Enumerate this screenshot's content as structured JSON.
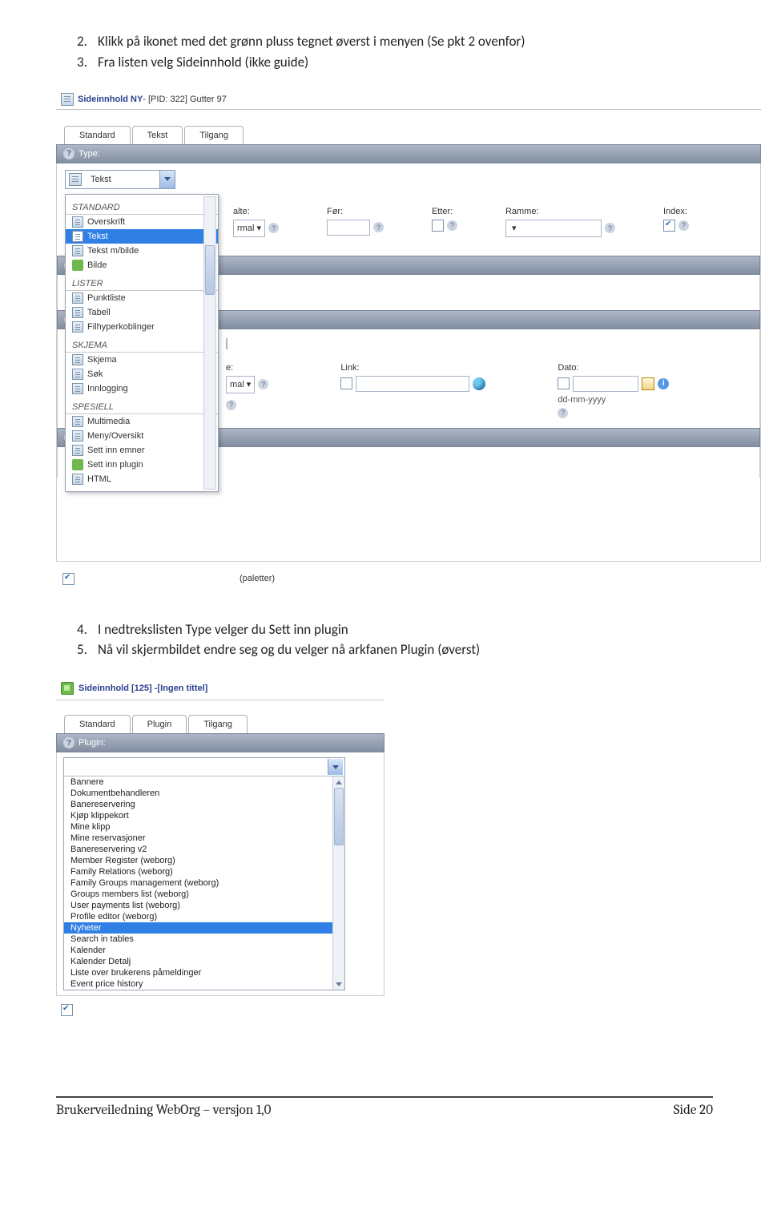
{
  "instructions": {
    "i2_num": "2.",
    "i2_text": "Klikk på ikonet med det grønn pluss tegnet øverst i menyen (Se pkt 2 ovenfor)",
    "i3_num": "3.",
    "i3_text": "Fra listen velg Sideinnhold (ikke guide)",
    "i4_num": "4.",
    "i4_text": "I nedtrekslisten Type velger du Sett inn plugin",
    "i5_num": "5.",
    "i5_text": "Nå vil skjermbildet endre seg og du velger nå arkfanen Plugin (øverst)"
  },
  "s1": {
    "title_prefix": "Sideinnhold NY",
    "title_pid": " - [PID: 322] Gutter 97",
    "tabs": {
      "t1": "Standard",
      "t2": "Tekst",
      "t3": "Tilgang"
    },
    "type_label": "Type:",
    "type_value": "Tekst",
    "groups": {
      "standard": "STANDARD",
      "lister": "LISTER",
      "skjema": "SKJEMA",
      "spesiell": "SPESIELL"
    },
    "items": {
      "overskrift": "Overskrift",
      "tekst": "Tekst",
      "tekst_bilde": "Tekst m/bilde",
      "bilde": "Bilde",
      "punktliste": "Punktliste",
      "tabell": "Tabell",
      "filhyper": "Filhyperkoblinger",
      "skjema": "Skjema",
      "sok": "Søk",
      "innlogging": "Innlogging",
      "multimedia": "Multimedia",
      "meny": "Meny/Oversikt",
      "sett_emner": "Sett inn emner",
      "sett_plugin": "Sett inn plugin",
      "html": "HTML"
    },
    "row_labels": {
      "alte": "alte:",
      "for": "Før:",
      "etter": "Etter:",
      "ramme": "Ramme:",
      "index": "Index:",
      "e_col": "e:",
      "link": "Link:",
      "dato": "Dato:",
      "normal": "rmal",
      "mal": "mal",
      "date_fmt": "dd-mm-yyyy",
      "paletter": "(paletter)"
    }
  },
  "s2": {
    "title_label": "Sideinnhold [125] - ",
    "title_sub": "[Ingen tittel]",
    "tabs": {
      "t1": "Standard",
      "t2": "Plugin",
      "t3": "Tilgang"
    },
    "plugin_label": "Plugin:",
    "options": [
      "Bannere",
      "Dokumentbehandleren",
      "Banereservering",
      "Kjøp klippekort",
      "Mine klipp",
      "Mine reservasjoner",
      "Banereservering v2",
      "Member Register (weborg)",
      "Family Relations (weborg)",
      "Family Groups management (weborg)",
      "Groups members list (weborg)",
      "User payments list (weborg)",
      "Profile editor (weborg)",
      "Nyheter",
      "Search in tables",
      "Kalender",
      "Kalender Detalj",
      "Liste over brukerens påmeldinger",
      "Event price history"
    ],
    "selected_index": 13
  },
  "footer": {
    "left": "Brukerveiledning WebOrg – versjon 1,0",
    "right": "Side 20"
  }
}
